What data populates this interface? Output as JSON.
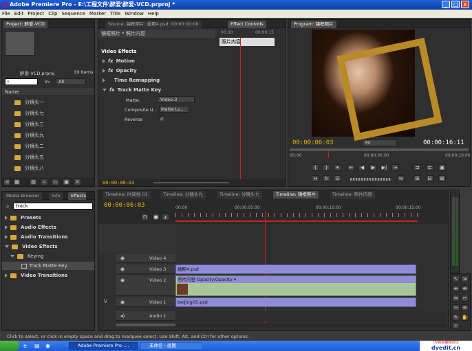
{
  "window": {
    "title": "Adobe Premiere Pro - E:\\工程文件\\醉爱\\醉爱-VCD.prproj *"
  },
  "menu": [
    "File",
    "Edit",
    "Project",
    "Clip",
    "Sequence",
    "Marker",
    "Title",
    "Window",
    "Help"
  ],
  "project": {
    "tab": "Project: 醉爱-VCD",
    "filename": "醉爱-VCD.prproj",
    "items": "19 Items",
    "in_label": "In:",
    "in_value": "All",
    "column": "Name",
    "bins": [
      "分镜头一",
      "分镜头七",
      "分镜头三",
      "分镜头九",
      "分镜头二",
      "分镜头五",
      "分镜头八"
    ]
  },
  "effect_controls": {
    "tab_source": "Source: 镜框照片: 婚照4.psd: 00:00:00:00",
    "tab_ec": "Effect Controls",
    "clip_header": "镜框照片 * 照片内容",
    "clip_label": "照片内容",
    "ruler_left": "00:00",
    "ruler_right": "00:00:15",
    "section": "Video Effects",
    "effects": [
      "Motion",
      "Opacity",
      "Time Remapping",
      "Track Matte Key"
    ],
    "matte_label": "Matte:",
    "matte_value": "Video 3",
    "composite_label": "Composite U...",
    "composite_value": "Matte Lu...",
    "reverse_label": "Reverse",
    "reverse_check": "✓",
    "timecode": "00:00:06:03"
  },
  "program": {
    "tab": "Program: 镜框照片",
    "current": "00:00:06:03",
    "fit": "Fit",
    "duration": "00:00:16:11",
    "ruler": [
      "00:00",
      "00:00:05:00",
      "00:00:10:00"
    ]
  },
  "effects_panel": {
    "tabs": [
      "Media Browser",
      "Info",
      "Effects"
    ],
    "search": "track",
    "tree": [
      "Presets",
      "Audio Effects",
      "Audio Transitions",
      "Video Effects",
      "Keying",
      "Track Matte Key",
      "Video Transitions"
    ]
  },
  "timeline": {
    "tabs": [
      "Timeline: 时间线 01",
      "Timeline: 分镜头九",
      "Timeline: 分镜头七",
      "Timeline: 镜框照片",
      "Timeline: 照片内容"
    ],
    "timecode": "00:00:06:03",
    "ruler": [
      "00:00",
      "00:00:05:00",
      "00:00:10:00",
      "00:00:15:00"
    ],
    "tracks": [
      "Video 4",
      "Video 3",
      "Video 2",
      "Video 1",
      "Audio 1"
    ],
    "clips": {
      "v3": "婚照4.psd",
      "v2": "照片内容  Opacity:Opacity ▾",
      "v1": "beijing05.psd"
    },
    "v_label": "V"
  },
  "status": "Click to select, or click in empty space and drag to marquee select. Use Shift, Alt, and Ctrl for other options.",
  "taskbar": {
    "app1": "Adobe Premiere Pro -...",
    "app2": "未命名 - 画图",
    "watermark1": "DV视频编辑论坛",
    "watermark2": "dvedit.cn"
  }
}
